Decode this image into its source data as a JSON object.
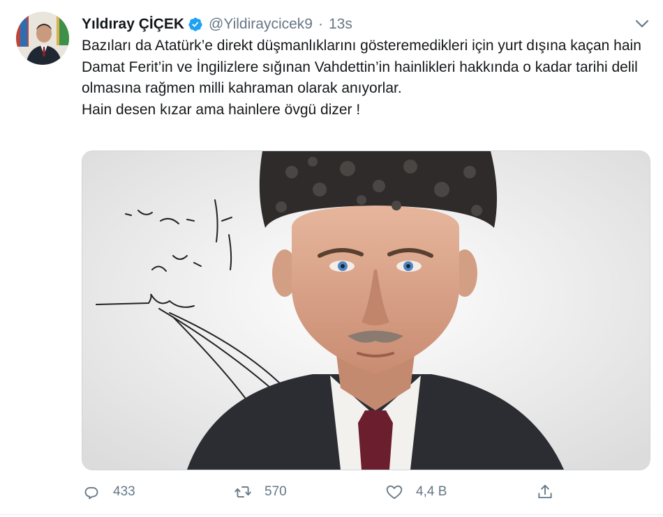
{
  "tweet": {
    "author": {
      "name": "Yıldıray ÇİÇEK",
      "handle": "@Yildiraycicek9",
      "verified": true
    },
    "separator": "·",
    "time": "13s",
    "text": {
      "paragraph1": "Bazıları da Atatürk’e direkt düşmanlıklarını gösteremedikleri için yurt dışına kaçan hain Damat Ferit’in ve İngilizlere sığınan Vahdettin’in hainlikleri hakkında o kadar tarihi delil olmasına rağmen  milli kahraman olarak anıyorlar.",
      "paragraph2": "Hain desen kızar ama hainlere övgü dizer !"
    },
    "media": {
      "type": "photo",
      "description_icon": "portrait-photo"
    },
    "actions": {
      "reply_count": "433",
      "retweet_count": "570",
      "like_count": "4,4 B"
    },
    "colors": {
      "verified_badge": "#1da1f2",
      "secondary_text": "#657786",
      "border": "#ccd6dd"
    }
  }
}
